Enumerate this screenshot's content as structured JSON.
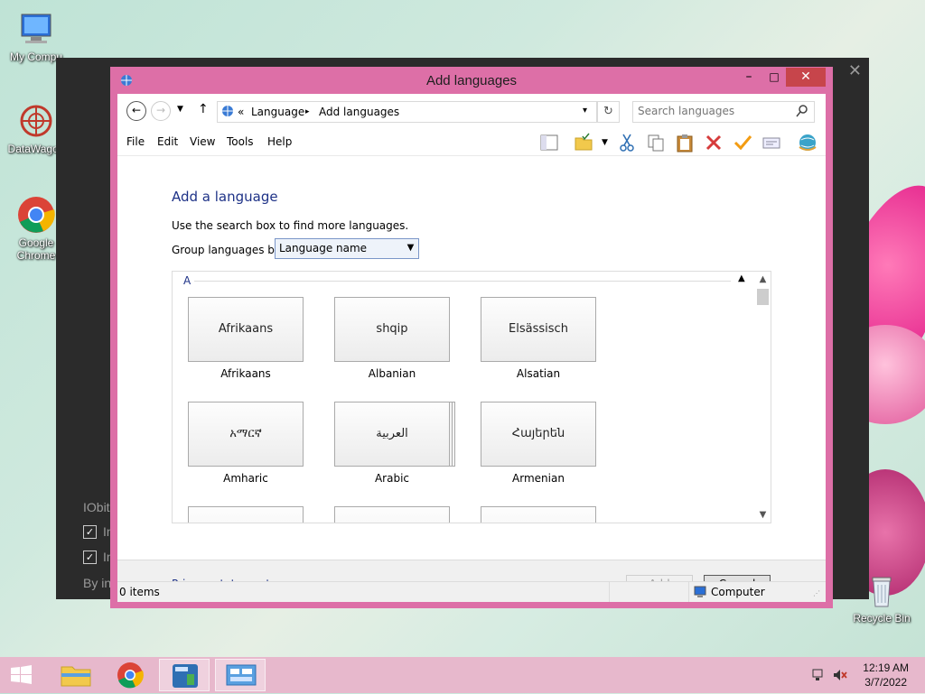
{
  "desktop": {
    "icons": [
      {
        "label": "My Compu",
        "icon": "my-computer-icon"
      },
      {
        "label": "DataWagon",
        "icon": "datawagon-icon"
      },
      {
        "label": "Google Chrome",
        "icon": "chrome-icon"
      },
      {
        "label": "Recycle Bin",
        "icon": "recycle-bin-icon"
      }
    ]
  },
  "background_window": {
    "lines": [
      "IObit",
      "In",
      "In",
      "By in"
    ]
  },
  "window": {
    "title": "Add languages",
    "controls": {
      "minimize": "–",
      "maximize": "□",
      "close": "✕"
    },
    "address": {
      "prefix": "«",
      "crumbs": [
        "Language",
        "Add languages"
      ],
      "separator": "▸"
    },
    "search": {
      "placeholder": "Search languages"
    },
    "menu": [
      "File",
      "Edit",
      "View",
      "Tools",
      "Help"
    ],
    "toolbar_icons": [
      "layout-pane-icon",
      "folder-check-icon",
      "cut-icon",
      "copy-icon",
      "paste-icon",
      "delete-icon",
      "check-icon",
      "properties-icon",
      "globe-icon"
    ],
    "heading": "Add a language",
    "instruction": "Use the search box to find more languages.",
    "group_label": "Group languages by:",
    "group_value": "Language name",
    "group_header": "A",
    "languages": [
      {
        "native": "Afrikaans",
        "name": "Afrikaans"
      },
      {
        "native": "shqip",
        "name": "Albanian"
      },
      {
        "native": "Elsässisch",
        "name": "Alsatian"
      },
      {
        "native": "አማርኛ",
        "name": "Amharic"
      },
      {
        "native": "العربية",
        "name": "Arabic"
      },
      {
        "native": "Հայերեն",
        "name": "Armenian"
      }
    ],
    "footer": {
      "privacy": "Privacy statement",
      "add": "Add",
      "cancel": "Cancel"
    },
    "status": {
      "items": "0 items",
      "location": "Computer"
    }
  },
  "taskbar": {
    "time": "12:19 AM",
    "date": "3/7/2022"
  },
  "colors": {
    "accent": "#dd6fa7",
    "link": "#1e3287"
  }
}
